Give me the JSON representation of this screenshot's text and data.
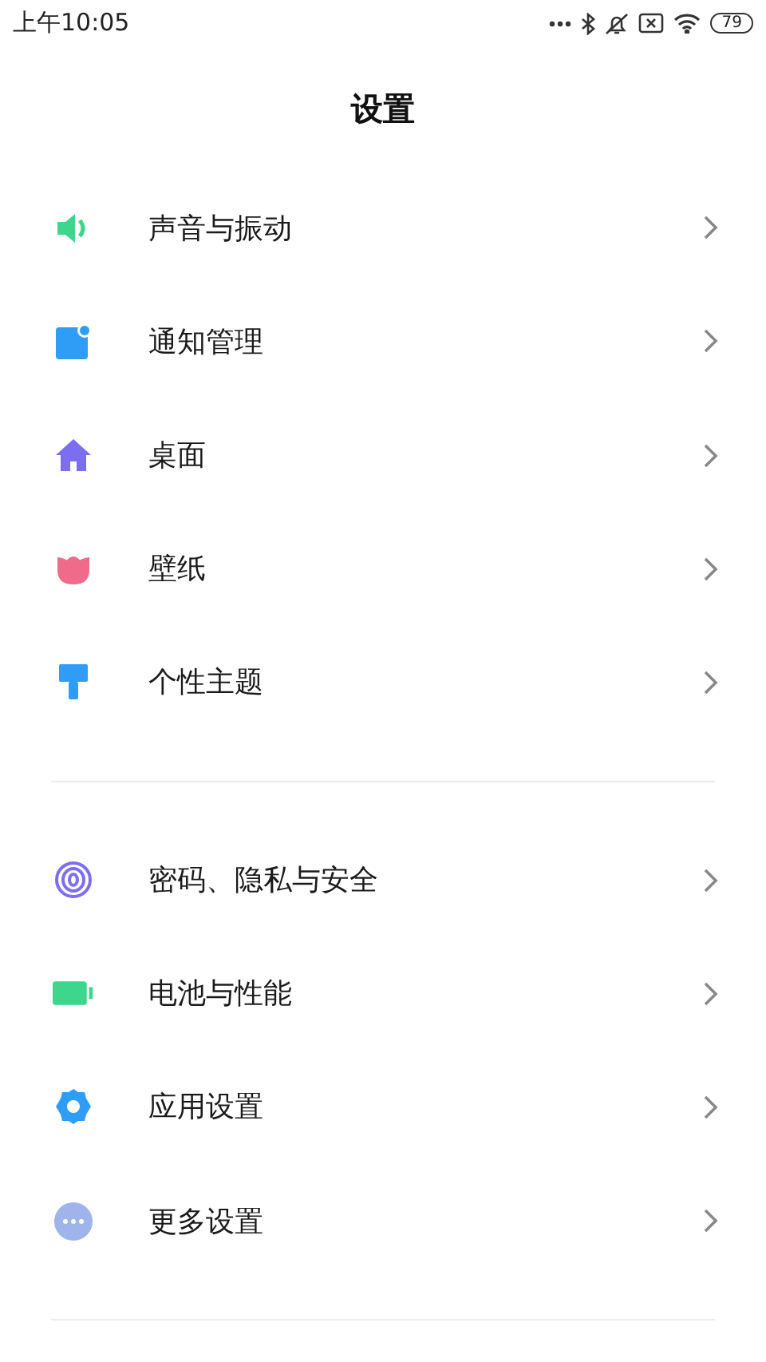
{
  "status_bar": {
    "time": "上午10:05",
    "battery": "79"
  },
  "title": "设置",
  "sections": [
    {
      "items": [
        {
          "label": "声音与振动"
        },
        {
          "label": "通知管理"
        },
        {
          "label": "桌面"
        },
        {
          "label": "壁纸"
        },
        {
          "label": "个性主题"
        }
      ]
    },
    {
      "items": [
        {
          "label": "密码、隐私与安全"
        },
        {
          "label": "电池与性能"
        },
        {
          "label": "应用设置"
        },
        {
          "label": "更多设置"
        }
      ]
    }
  ]
}
